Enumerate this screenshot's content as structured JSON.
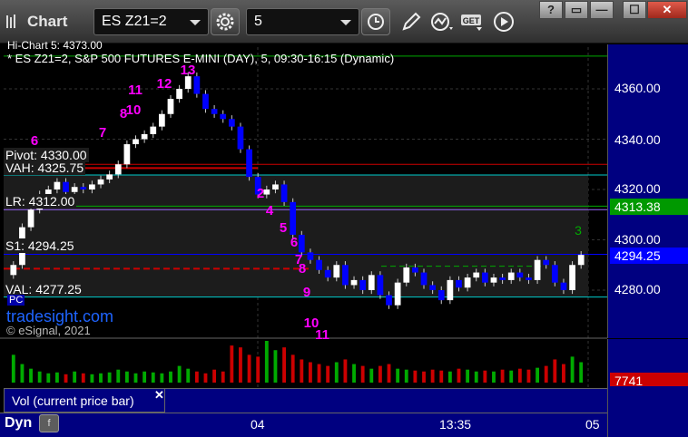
{
  "window": {
    "title": "Chart",
    "controls": [
      "?",
      "▭",
      "—",
      "☐",
      "✕"
    ]
  },
  "toolbar": {
    "symbol": "ES Z21=2",
    "interval": "5",
    "buttons": [
      "gear-icon",
      "clock-icon",
      "pencil-icon",
      "indicator-icon",
      "get-icon",
      "play-icon"
    ],
    "get_label": "GET"
  },
  "chart": {
    "header_top": "Hi-Chart 5: 4373.00",
    "header": "* ES Z21=2, S&P 500 FUTURES E-MINI (DAY), 5, 09:30-16:15 (Dynamic)",
    "price_ticks": [
      "4360.00",
      "4340.00",
      "4320.00",
      "4300.00",
      "4280.00"
    ],
    "price_tag_green": {
      "value": "4313.38",
      "color": "#009900"
    },
    "price_tag_blue": {
      "value": "4294.25",
      "color": "#0000ff"
    },
    "volume_tag": {
      "value": "7741",
      "color": "#cc0000"
    },
    "levels": {
      "pivot": "Pivot: 4330.00",
      "vah": "VAH: 4325.75",
      "lr": "LR: 4312.00",
      "s1": "S1: 4294.25",
      "val": "VAL: 4277.25",
      "pc": "PC"
    },
    "watermark": "tradesight.com",
    "copyright": "© eSignal, 2021",
    "volume_panel_label": "Vol (current price bar)",
    "time_labels": [
      "04",
      "13:35",
      "05"
    ],
    "dyn_label": "Dyn",
    "counts_magenta": [
      "6",
      "7",
      "8",
      "10",
      "11",
      "12",
      "13",
      "2",
      "4",
      "5",
      "6",
      "7",
      "8",
      "9",
      "10",
      "11"
    ],
    "counts_green": [
      "3"
    ],
    "colors": {
      "up_candle": "#ffffff",
      "down_candle": "#0000ff",
      "pivot_line": "#cc0000",
      "vah_line": "#00cccc",
      "lr_line": "#9966ff",
      "s1_line": "#0000ff",
      "val_line": "#00cccc",
      "count_magenta": "#ff00ff",
      "count_green": "#00aa00"
    }
  },
  "chart_data": {
    "type": "candlestick",
    "title": "* ES Z21=2, S&P 500 FUTURES E-MINI (DAY), 5, 09:30-16:15 (Dynamic)",
    "ylim": [
      4268,
      4375
    ],
    "price_ticks": [
      4360,
      4340,
      4320,
      4300,
      4280
    ],
    "closes": [
      4290,
      4305,
      4312,
      4318,
      4320,
      4323,
      4319,
      4321,
      4320,
      4322,
      4324,
      4326,
      4330,
      4338,
      4340,
      4342,
      4345,
      4350,
      4356,
      4360,
      4365,
      4358,
      4352,
      4350,
      4348,
      4345,
      4336,
      4325,
      4318,
      4320,
      4322,
      4315,
      4302,
      4295,
      4292,
      4288,
      4285,
      4290,
      4282,
      4284,
      4280,
      4286,
      4278,
      4274,
      4283,
      4289,
      4287,
      4282,
      4280,
      4276,
      4284,
      4281,
      4285,
      4287,
      4283,
      4285,
      4284,
      4287,
      4285,
      4284,
      4292,
      4290,
      4283,
      4280,
      4290,
      4294
    ],
    "volume": [
      30,
      20,
      15,
      12,
      10,
      11,
      9,
      12,
      10,
      9,
      10,
      11,
      14,
      12,
      10,
      12,
      11,
      10,
      12,
      18,
      15,
      12,
      10,
      14,
      12,
      40,
      38,
      30,
      28,
      45,
      35,
      38,
      30,
      25,
      22,
      20,
      18,
      22,
      25,
      20,
      18,
      15,
      18,
      20,
      15,
      14,
      13,
      12,
      14,
      13,
      12,
      15,
      14,
      12,
      13,
      12,
      14,
      13,
      15,
      14,
      16,
      18,
      25,
      20,
      28,
      22
    ]
  }
}
